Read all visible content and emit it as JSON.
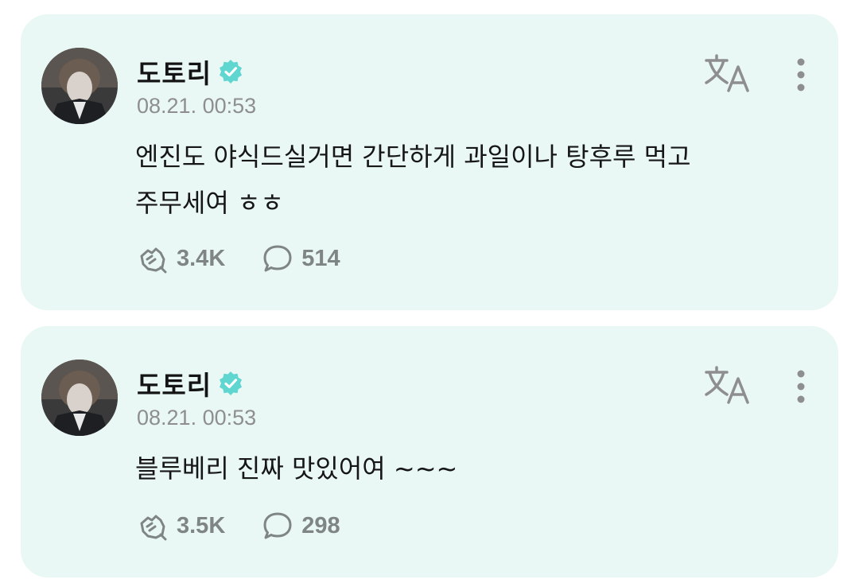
{
  "posts": [
    {
      "author": "도토리",
      "date": "08.21. 00:53",
      "text_lines": [
        "엔진도 야식드실거면 간단하게 과일이나 탕후루 먹고",
        "주무세여 ㅎㅎ"
      ],
      "likes": "3.4K",
      "comments": "514"
    },
    {
      "author": "도토리",
      "date": "08.21. 00:53",
      "text_lines": [
        "블루베리 진짜 맛있어여 ~~~"
      ],
      "likes": "3.5K",
      "comments": "298"
    }
  ],
  "icons": {
    "verified": "verified-badge-icon",
    "translate": "translate-icon",
    "more": "more-vertical-icon",
    "like": "like-hand-icon",
    "comment": "comment-bubble-icon"
  },
  "colors": {
    "card_bg": "#e9f8f5",
    "verified": "#5fd6d0",
    "muted": "#8e8e8e",
    "stat": "#7f8584"
  }
}
